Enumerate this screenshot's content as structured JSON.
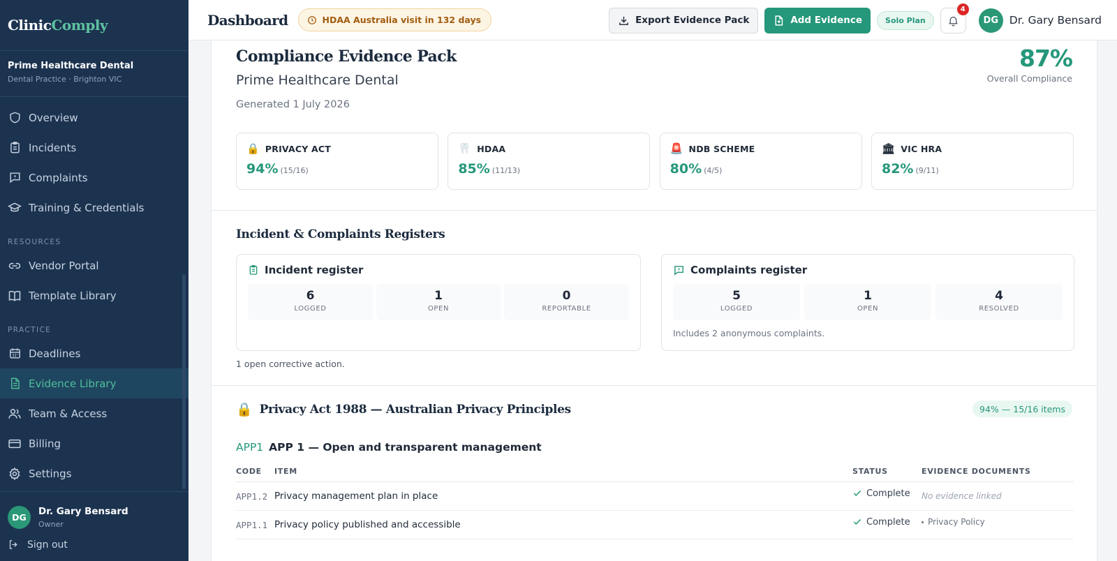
{
  "brand": {
    "part1": "Clinic",
    "part2": "Comply"
  },
  "practice": {
    "name": "Prime Healthcare Dental",
    "location": "Dental Practice · Brighton VIC"
  },
  "nav": {
    "main": [
      {
        "label": "Overview",
        "icon": "shield-icon"
      },
      {
        "label": "Incidents",
        "icon": "clipboard-icon"
      },
      {
        "label": "Complaints",
        "icon": "message-alert-icon"
      },
      {
        "label": "Training & Credentials",
        "icon": "graduation-cap-icon"
      }
    ],
    "resources_label": "RESOURCES",
    "resources": [
      {
        "label": "Vendor Portal",
        "icon": "link-icon"
      },
      {
        "label": "Template Library",
        "icon": "book-icon"
      }
    ],
    "practice_label": "PRACTICE",
    "practice": [
      {
        "label": "Deadlines",
        "icon": "calendar-icon"
      },
      {
        "label": "Evidence Library",
        "icon": "file-text-icon",
        "active": true
      },
      {
        "label": "Team & Access",
        "icon": "users-icon"
      },
      {
        "label": "Billing",
        "icon": "credit-card-icon"
      },
      {
        "label": "Settings",
        "icon": "gear-icon"
      }
    ]
  },
  "user": {
    "initials": "DG",
    "name": "Dr. Gary Bensard",
    "role": "Owner",
    "signout": "Sign out"
  },
  "topbar": {
    "title": "Dashboard",
    "visit_badge": "HDAA Australia visit in 132 days",
    "export_label": "Export Evidence Pack",
    "add_label": "Add Evidence",
    "plan": "Solo Plan",
    "notifications": "4"
  },
  "pack": {
    "title": "Compliance Evidence Pack",
    "subtitle": "Prime Healthcare Dental",
    "generated": "Generated 1 July 2026",
    "overall_pct": "87%",
    "overall_label": "Overall Compliance",
    "frameworks": [
      {
        "emoji": "🔒",
        "name": "PRIVACY ACT",
        "pct": "94%",
        "frac": "(15/16)"
      },
      {
        "emoji": "🦷",
        "name": "HDAA",
        "pct": "85%",
        "frac": "(11/13)"
      },
      {
        "emoji": "🚨",
        "name": "NDB SCHEME",
        "pct": "80%",
        "frac": "(4/5)"
      },
      {
        "emoji": "🏛",
        "name": "VIC HRA",
        "pct": "82%",
        "frac": "(9/11)"
      }
    ]
  },
  "registers": {
    "title": "Incident & Complaints Registers",
    "incident": {
      "title": "Incident register",
      "stats": [
        {
          "value": "6",
          "label": "LOGGED"
        },
        {
          "value": "1",
          "label": "OPEN"
        },
        {
          "value": "0",
          "label": "REPORTABLE"
        }
      ]
    },
    "complaints": {
      "title": "Complaints register",
      "stats": [
        {
          "value": "5",
          "label": "LOGGED"
        },
        {
          "value": "1",
          "label": "OPEN"
        },
        {
          "value": "4",
          "label": "RESOLVED"
        }
      ],
      "note": "Includes 2 anonymous complaints."
    },
    "corrective": "1 open corrective action."
  },
  "privacy": {
    "emoji": "🔒",
    "title": "Privacy Act 1988 — Australian Privacy Principles",
    "badge": "94% — 15/16 items",
    "app_code": "APP1",
    "app_name": "APP 1 — Open and transparent management",
    "columns": {
      "code": "CODE",
      "item": "ITEM",
      "status": "STATUS",
      "docs": "EVIDENCE DOCUMENTS"
    },
    "rows": [
      {
        "code": "APP1.2",
        "item": "Privacy management plan in place",
        "status": "Complete",
        "docs": "No evidence linked",
        "has_docs": false
      },
      {
        "code": "APP1.1",
        "item": "Privacy policy published and accessible",
        "status": "Complete",
        "docs": "Privacy Policy",
        "has_docs": true
      }
    ]
  },
  "colors": {
    "accent": "#25977a",
    "sidebar": "#1c3350",
    "warning": "#a15c10",
    "danger": "#dc2626"
  }
}
